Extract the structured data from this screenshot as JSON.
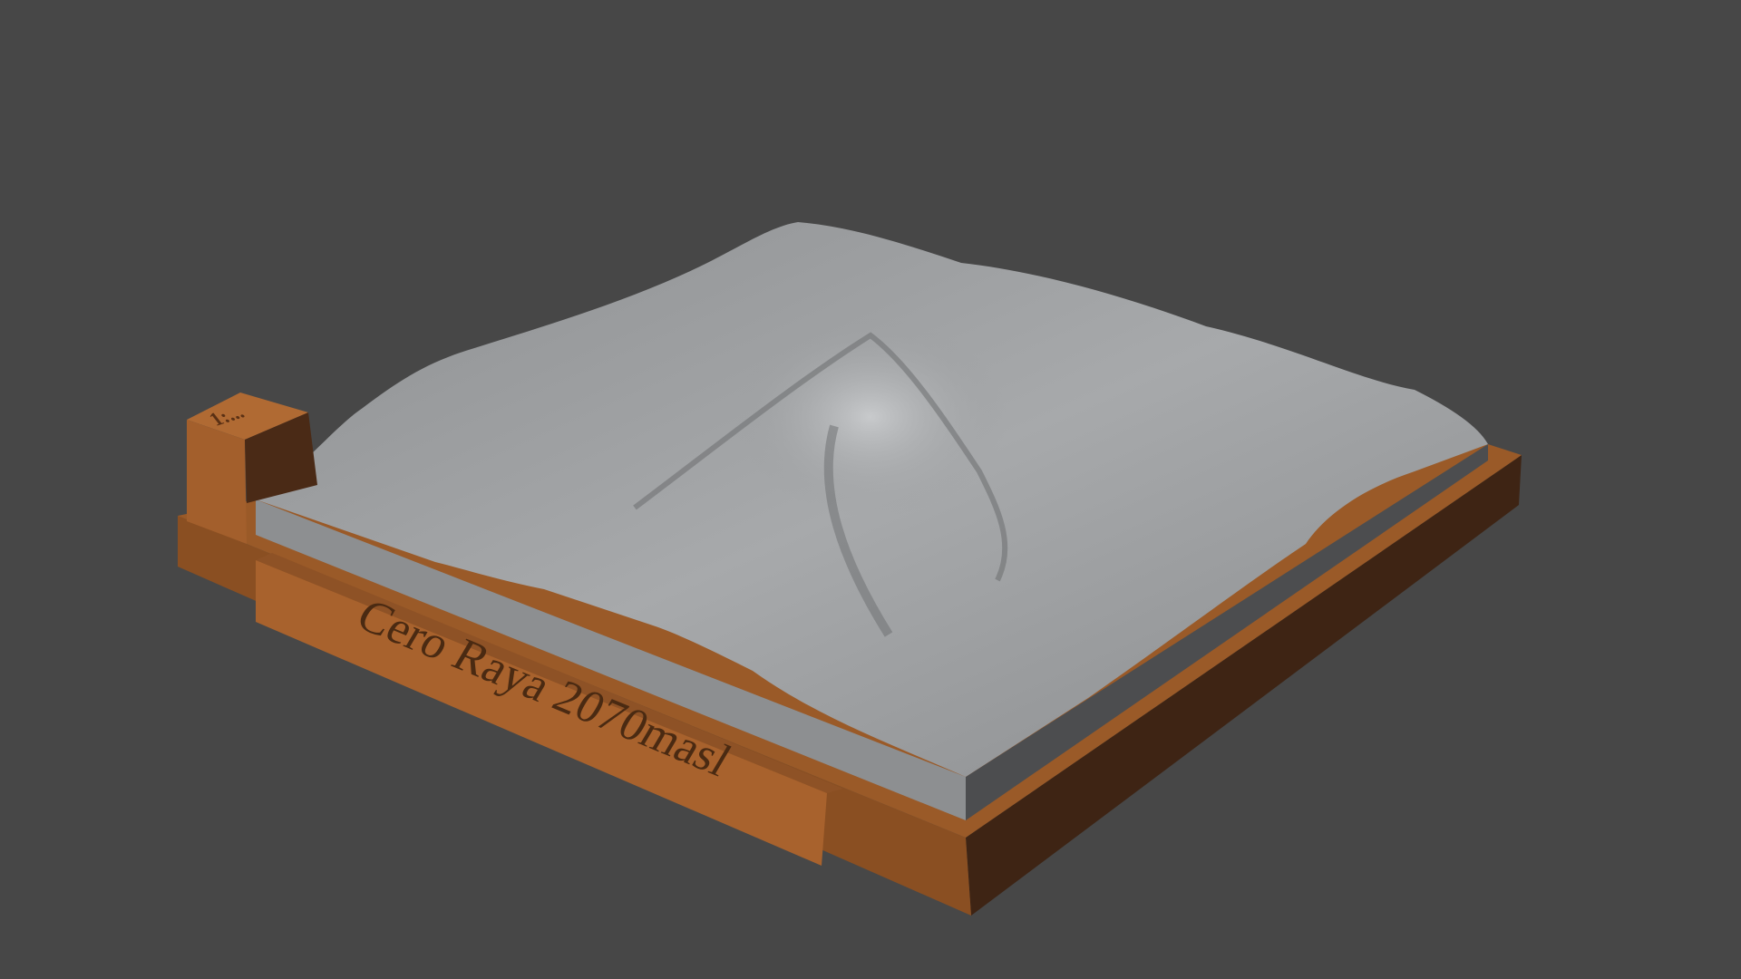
{
  "scene": {
    "subject": "3D printed terrain relief model",
    "engraved_label": "Cero Raya 2070masl",
    "block_engraving": "1:..."
  },
  "colors": {
    "background": "#474747",
    "base": "#a8622d",
    "base_dark": "#3e2414",
    "terrain": "#9a9c9e",
    "slab_side": "#4c4d4f"
  }
}
